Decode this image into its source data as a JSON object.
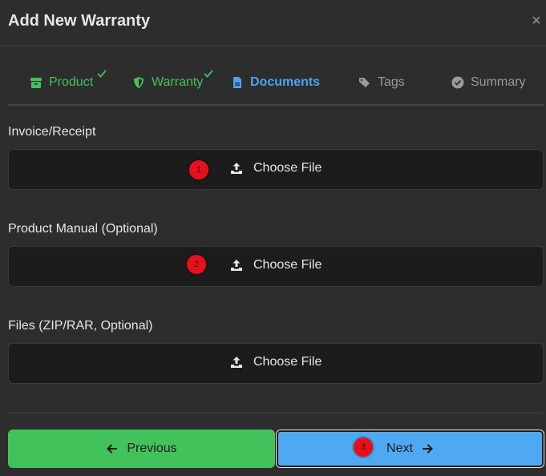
{
  "modal": {
    "title": "Add New Warranty",
    "close_label": "×"
  },
  "steps": [
    {
      "label": "Product",
      "state": "done",
      "icon": "box-icon"
    },
    {
      "label": "Warranty",
      "state": "done",
      "icon": "shield-icon"
    },
    {
      "label": "Documents",
      "state": "active",
      "icon": "document-icon"
    },
    {
      "label": "Tags",
      "state": "pending",
      "icon": "tags-icon"
    },
    {
      "label": "Summary",
      "state": "pending",
      "icon": "check-circle-icon"
    }
  ],
  "fields": [
    {
      "label": "Invoice/Receipt",
      "button": "Choose File"
    },
    {
      "label": "Product Manual (Optional)",
      "button": "Choose File"
    },
    {
      "label": "Files (ZIP/RAR, Optional)",
      "button": "Choose File"
    }
  ],
  "badges": [
    "1",
    "2",
    "3"
  ],
  "footer": {
    "previous_label": "Previous",
    "next_label": "Next"
  },
  "colors": {
    "done": "#45c35a",
    "active": "#4ea3f0",
    "pending": "#9a9a9a",
    "previous_button": "#43c15b",
    "next_button": "#4ea9f2",
    "badge": "#e8101a"
  }
}
